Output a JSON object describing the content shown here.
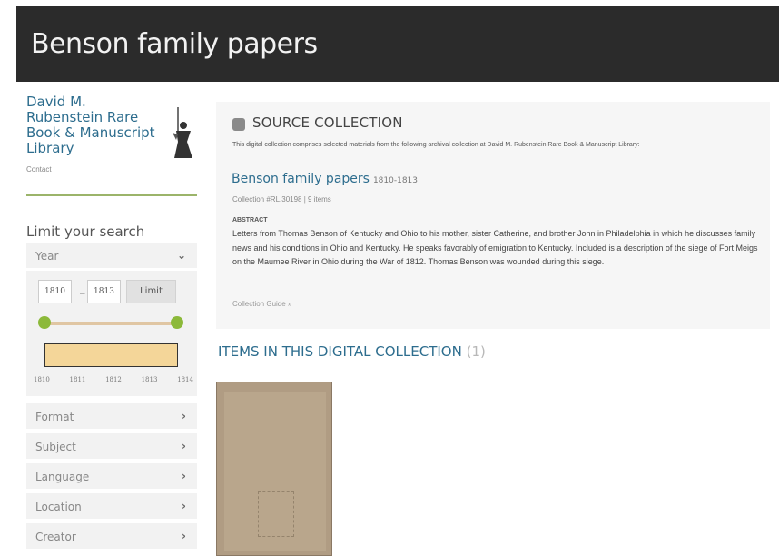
{
  "header": {
    "title": "Benson family papers"
  },
  "sidebar": {
    "library_name": "David M. Rubenstein Rare Book & Manuscript Library",
    "contact": "Contact",
    "limit_title": "Limit your search",
    "year_facet": {
      "label": "Year",
      "from": "1810",
      "to": "1813",
      "dash": "–",
      "button": "Limit",
      "range_start": 1810,
      "range_end": 1813,
      "ticks": [
        "1810",
        "1811",
        "1812",
        "1813",
        "1814"
      ]
    },
    "facets": [
      {
        "label": "Format"
      },
      {
        "label": "Subject"
      },
      {
        "label": "Language"
      },
      {
        "label": "Location"
      },
      {
        "label": "Creator"
      }
    ]
  },
  "source": {
    "heading": "SOURCE COLLECTION",
    "description": "This digital collection comprises selected materials from the following archival collection at David M. Rubenstein Rare Book & Manuscript Library:",
    "collection_title": "Benson family papers",
    "collection_dates": "1810-1813",
    "collection_meta": "Collection #RL.30198 | 9 items",
    "abstract_label": "ABSTRACT",
    "abstract": "Letters from Thomas Benson of Kentucky and Ohio to his mother, sister Catherine, and brother John in Philadelphia in which he discusses family news and his conditions in Ohio and Kentucky. He speaks favorably of emigration to Kentucky. Included is a description of the siege of Fort Meigs on the Maumee River in Ohio during the War of 1812. Thomas Benson was wounded during this siege.",
    "guide_link": "Collection Guide »"
  },
  "items": {
    "heading": "ITEMS IN THIS DIGITAL COLLECTION",
    "count": "(1)"
  },
  "colors": {
    "header_bg": "#2b2b2b",
    "link": "#2d6d8e",
    "accent_green": "#8cb93a",
    "histogram_fill": "#f4d699"
  }
}
